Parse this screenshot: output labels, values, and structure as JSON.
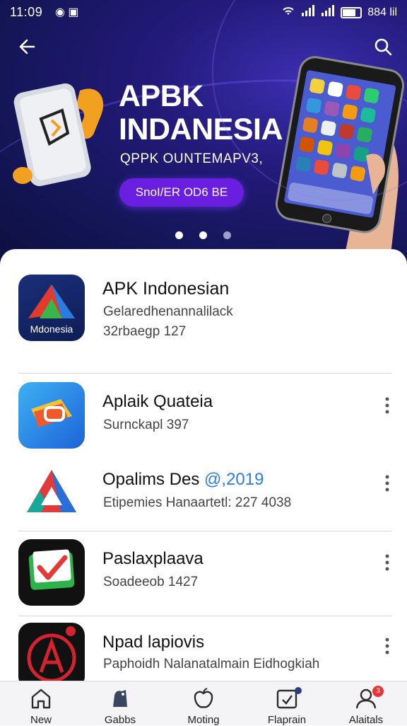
{
  "status_bar": {
    "time": "11:09",
    "right_text": "884 lil"
  },
  "hero": {
    "headline_line1": "APBK",
    "headline_line2": "INDANESIA",
    "subline": "QPPK OUNTEMAPV3,",
    "cta_label": "SnoI/ER OD6 BE",
    "slides": 3,
    "active_slide": 1
  },
  "colors": {
    "accent": "#6a1fe0",
    "hero_bg": "#141658",
    "link": "#2b7de0"
  },
  "apps": [
    {
      "title": "APK Indonesian",
      "line1": "Gelaredhenannalilack",
      "line2": "32rbaegp  127",
      "icon_label": "Mdonesia"
    },
    {
      "title": "Aplaik Quateia",
      "line1": "Surnckapl 397"
    },
    {
      "title": "Opalims Des ",
      "title_accent": "@,2019",
      "line1": "Etipemies Hanaartetl: 227 4038"
    },
    {
      "title": "Paslaxplaava",
      "line1": "Soadeeob 1427"
    },
    {
      "title": "Npad lapiovis",
      "line1": "Paphoidh Nalanatalmain Eidhogkiah"
    }
  ],
  "bottom_nav": [
    {
      "label": "New",
      "icon": "home-icon"
    },
    {
      "label": "Gabbs",
      "icon": "game-icon"
    },
    {
      "label": "Moting",
      "icon": "apple-icon"
    },
    {
      "label": "Flaprain",
      "icon": "update-icon",
      "badge": ""
    },
    {
      "label": "Alaitals",
      "icon": "profile-icon",
      "badge": "3"
    }
  ]
}
